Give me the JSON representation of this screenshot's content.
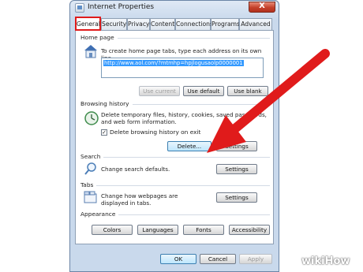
{
  "window": {
    "title": "Internet Properties",
    "close_label": "X"
  },
  "tabs": [
    {
      "label": "General"
    },
    {
      "label": "Security"
    },
    {
      "label": "Privacy"
    },
    {
      "label": "Content"
    },
    {
      "label": "Connections"
    },
    {
      "label": "Programs"
    },
    {
      "label": "Advanced"
    }
  ],
  "home_page": {
    "heading": "Home page",
    "description": "To create home page tabs, type each address on its own line.",
    "url": "http://www.aol.com/?mtmhp=hpjlogusaolp0000001",
    "use_current": "Use current",
    "use_default": "Use default",
    "use_blank": "Use blank"
  },
  "browsing_history": {
    "heading": "Browsing history",
    "description": "Delete temporary files, history, cookies, saved passwords, and web form information.",
    "checkbox_label": "Delete browsing history on exit",
    "checkbox_mark": "✓",
    "delete": "Delete...",
    "settings": "Settings"
  },
  "search": {
    "heading": "Search",
    "description": "Change search defaults.",
    "settings": "Settings"
  },
  "tabs_section": {
    "heading": "Tabs",
    "description": "Change how webpages are displayed in tabs.",
    "settings": "Settings"
  },
  "appearance": {
    "heading": "Appearance",
    "colors": "Colors",
    "languages": "Languages",
    "fonts": "Fonts",
    "accessibility": "Accessibility"
  },
  "dialog_buttons": {
    "ok": "OK",
    "cancel": "Cancel",
    "apply": "Apply"
  },
  "watermark": "wikiHow",
  "colors": {
    "highlight": "#e01b1b",
    "selection": "#3399ff"
  }
}
